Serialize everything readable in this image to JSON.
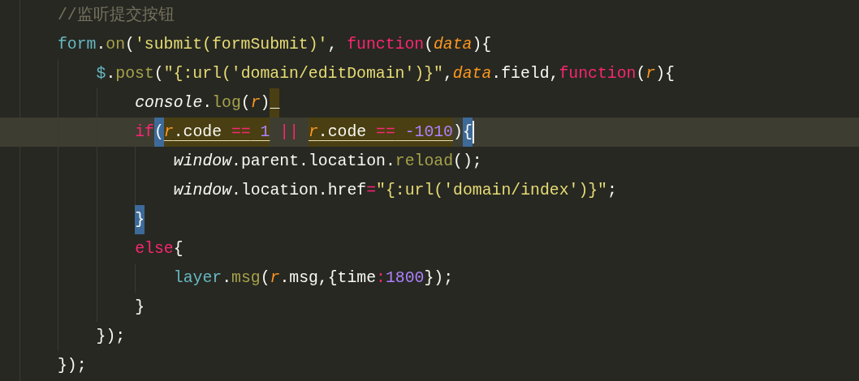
{
  "lines": [
    {
      "tokens": [
        {
          "kind": "comment",
          "text": "//监听提交按钮"
        }
      ]
    },
    {
      "tokens": [
        {
          "kind": "object",
          "text": "form"
        },
        {
          "kind": "plain",
          "text": "."
        },
        {
          "kind": "method",
          "text": "on"
        },
        {
          "kind": "plain",
          "text": "("
        },
        {
          "kind": "string",
          "text": "'submit(formSubmit)'"
        },
        {
          "kind": "plain",
          "text": ", "
        },
        {
          "kind": "keyword",
          "text": "function"
        },
        {
          "kind": "plain",
          "text": "("
        },
        {
          "kind": "param",
          "text": "data"
        },
        {
          "kind": "plain",
          "text": "){"
        }
      ],
      "children": [
        {
          "tokens": [
            {
              "kind": "object",
              "text": "$"
            },
            {
              "kind": "plain",
              "text": "."
            },
            {
              "kind": "method",
              "text": "post"
            },
            {
              "kind": "plain",
              "text": "("
            },
            {
              "kind": "string",
              "text": "\"{:url('domain/editDomain')}\""
            },
            {
              "kind": "plain",
              "text": ","
            },
            {
              "kind": "param",
              "text": "data"
            },
            {
              "kind": "plain",
              "text": ".field,"
            },
            {
              "kind": "keyword",
              "text": "function"
            },
            {
              "kind": "plain",
              "text": "("
            },
            {
              "kind": "param",
              "text": "r"
            },
            {
              "kind": "plain",
              "text": "){"
            }
          ],
          "children": [
            {
              "tokens": [
                {
                  "kind": "builtin",
                  "text": "console"
                },
                {
                  "kind": "plain",
                  "text": "."
                },
                {
                  "kind": "method",
                  "text": "log"
                },
                {
                  "kind": "plain",
                  "text": "("
                },
                {
                  "kind": "param",
                  "text": "r"
                },
                {
                  "kind": "plain",
                  "text": ")"
                },
                {
                  "kind": "plain",
                  "text": "_",
                  "marked": true
                }
              ]
            },
            {
              "current": true,
              "tokens": [
                {
                  "kind": "keyword",
                  "text": "if"
                },
                {
                  "kind": "plain",
                  "text": "(",
                  "bracket_match": true
                },
                {
                  "kind": "param",
                  "text": "r",
                  "occurrence": true
                },
                {
                  "kind": "plain",
                  "text": ".code ",
                  "occurrence": true
                },
                {
                  "kind": "keyword",
                  "text": "==",
                  "occurrence": true
                },
                {
                  "kind": "number",
                  "text": " 1",
                  "occurrence": true
                },
                {
                  "kind": "keyword",
                  "text": " || "
                },
                {
                  "kind": "param",
                  "text": "r",
                  "occurrence": true
                },
                {
                  "kind": "plain",
                  "text": ".code ",
                  "occurrence": true
                },
                {
                  "kind": "keyword",
                  "text": "==",
                  "occurrence": true
                },
                {
                  "kind": "number",
                  "text": " -1010",
                  "occurrence": true
                },
                {
                  "kind": "plain",
                  "text": ")"
                },
                {
                  "kind": "plain",
                  "text": "{",
                  "bracket_match": true,
                  "cursor": true
                }
              ],
              "children": [
                {
                  "tokens": [
                    {
                      "kind": "builtin",
                      "text": "window"
                    },
                    {
                      "kind": "plain",
                      "text": ".parent.location."
                    },
                    {
                      "kind": "method",
                      "text": "reload"
                    },
                    {
                      "kind": "plain",
                      "text": "();"
                    }
                  ]
                },
                {
                  "tokens": [
                    {
                      "kind": "builtin",
                      "text": "window"
                    },
                    {
                      "kind": "plain",
                      "text": ".location.href"
                    },
                    {
                      "kind": "keyword",
                      "text": "="
                    },
                    {
                      "kind": "string",
                      "text": "\"{:url('domain/index')}\""
                    },
                    {
                      "kind": "plain",
                      "text": ";"
                    }
                  ]
                }
              ]
            },
            {
              "tokens": [
                {
                  "kind": "plain",
                  "text": "}",
                  "bracket_match": true
                }
              ]
            },
            {
              "tokens": [
                {
                  "kind": "keyword",
                  "text": "else"
                },
                {
                  "kind": "plain",
                  "text": "{"
                }
              ],
              "children": [
                {
                  "tokens": [
                    {
                      "kind": "object",
                      "text": "layer"
                    },
                    {
                      "kind": "plain",
                      "text": "."
                    },
                    {
                      "kind": "method",
                      "text": "msg"
                    },
                    {
                      "kind": "plain",
                      "text": "("
                    },
                    {
                      "kind": "param",
                      "text": "r"
                    },
                    {
                      "kind": "plain",
                      "text": ".msg,{time"
                    },
                    {
                      "kind": "keyword",
                      "text": ":"
                    },
                    {
                      "kind": "number",
                      "text": "1800"
                    },
                    {
                      "kind": "plain",
                      "text": "});"
                    }
                  ]
                }
              ]
            },
            {
              "tokens": [
                {
                  "kind": "plain",
                  "text": "}"
                }
              ]
            }
          ]
        },
        {
          "tokens": [
            {
              "kind": "plain",
              "text": "});"
            }
          ]
        }
      ]
    },
    {
      "tokens": [
        {
          "kind": "plain",
          "text": "});"
        }
      ]
    }
  ]
}
